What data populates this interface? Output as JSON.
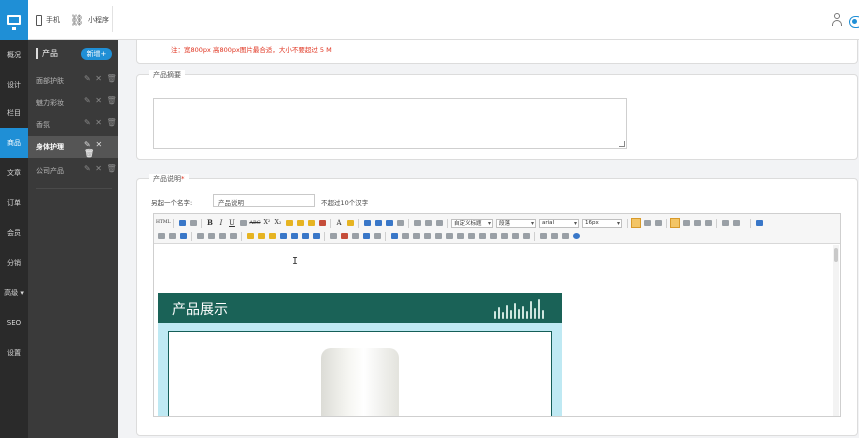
{
  "topbar": {
    "mobile_label": "手机",
    "mini_program_label": "小程序"
  },
  "leftnav": {
    "items": [
      {
        "label": "概况"
      },
      {
        "label": "设计"
      },
      {
        "label": "栏目"
      },
      {
        "label": "商品",
        "active": true
      },
      {
        "label": "文章"
      },
      {
        "label": "订单"
      },
      {
        "label": "会员"
      },
      {
        "label": "分销"
      },
      {
        "label": "高级 ▾"
      },
      {
        "label": "SEO"
      },
      {
        "label": "设置"
      }
    ]
  },
  "subnav": {
    "title": "产品",
    "add_label": "新增+",
    "ops": "✎ ✕ 🗑",
    "items": [
      {
        "label": "面部护肤"
      },
      {
        "label": "魅力彩妆"
      },
      {
        "label": "香氛"
      },
      {
        "label": "身体护理",
        "active": true
      },
      {
        "label": "公司产品"
      }
    ]
  },
  "form": {
    "image_note": "注：宽800px 高800px图片最合适，大小不要超过 5 M",
    "summary_title": "产品摘要",
    "description_title": "产品说明",
    "required_mark": "*",
    "alias_label": "另起一个名字:",
    "alias_value": "产品说明",
    "alias_hint": "不超过10个汉字"
  },
  "editor": {
    "toolbar": {
      "source": "HTML",
      "bold": "B",
      "italic": "I",
      "underline": "U",
      "strike": "ABC",
      "superscript": "X²",
      "subscript": "X₂",
      "font_color": "A",
      "custom_style": "自定义标题",
      "paragraph": "段落",
      "font_family": "arial",
      "font_size": "16px"
    },
    "banner_title": "产品展示"
  }
}
